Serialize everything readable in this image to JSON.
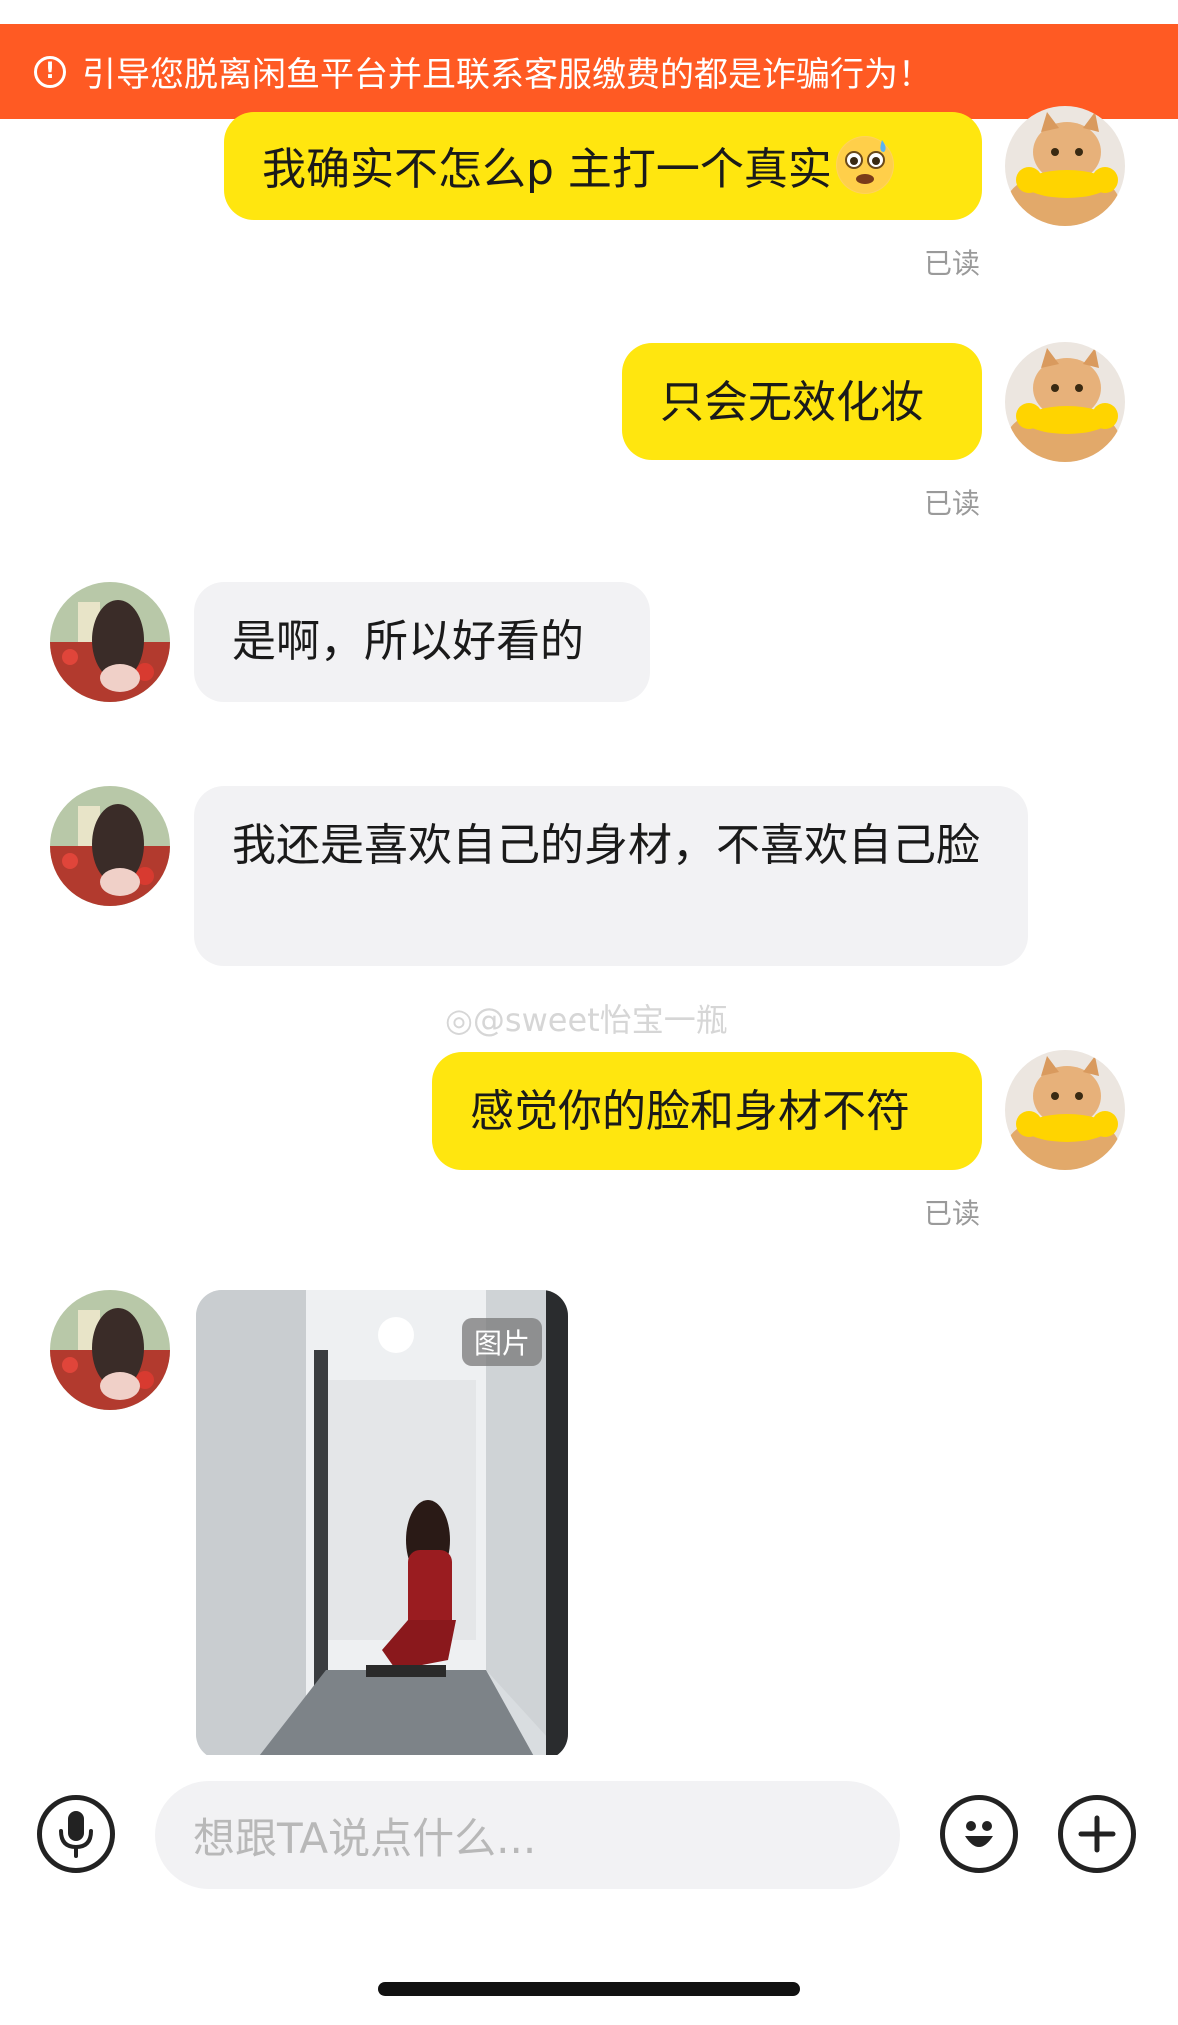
{
  "banner": {
    "text": "引导您脱离闲鱼平台并且联系客服缴费的都是诈骗行为！",
    "icon": "warning-circle-icon"
  },
  "messages": [
    {
      "side": "out",
      "text": "我确实不怎么p 主打一个真实",
      "status": "已读",
      "emoji": "anxious-face-emoji"
    },
    {
      "side": "out",
      "text": "只会无效化妆",
      "status": "已读"
    },
    {
      "side": "in",
      "text": "是啊，所以好看的"
    },
    {
      "side": "in",
      "text": "我还是喜欢自己的身材，不喜欢自己脸"
    },
    {
      "side": "out",
      "text": "感觉你的脸和身材不符",
      "status": "已读"
    },
    {
      "side": "in",
      "type": "image",
      "tag": "图片"
    }
  ],
  "watermark": "@sweet怡宝一瓶",
  "input": {
    "placeholder": "想跟TA说点什么..."
  },
  "icons": {
    "voice": "microphone-icon",
    "emoji": "smiley-icon",
    "more": "plus-icon"
  },
  "colors": {
    "banner": "#ff5a23",
    "outgoing_bubble": "#ffe60f",
    "incoming_bubble": "#f2f2f4"
  }
}
